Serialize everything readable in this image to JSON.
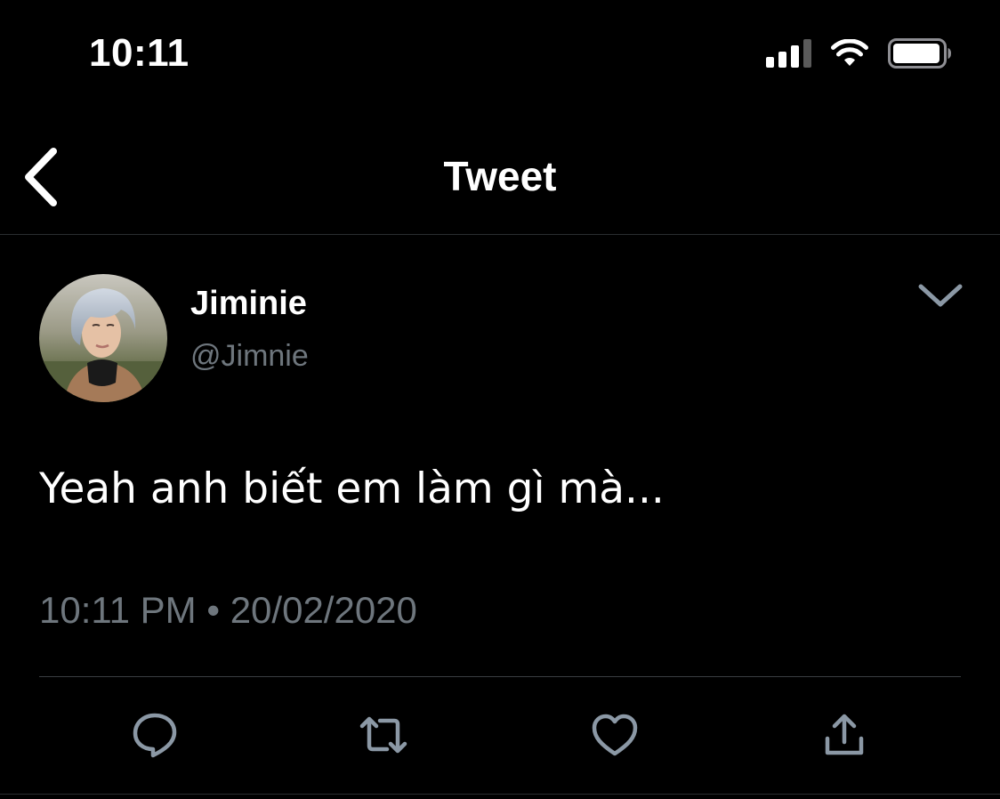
{
  "status_bar": {
    "time": "10:11"
  },
  "nav": {
    "title": "Tweet",
    "back_icon": "chevron-left-icon"
  },
  "tweet": {
    "display_name": "Jiminie",
    "handle": "@Jimnie",
    "text": "Yeah anh biết em làm gì mà...",
    "timestamp": "10:11 PM • 20/02/2020",
    "menu_icon": "chevron-down-icon"
  },
  "actions": [
    {
      "name": "reply",
      "icon": "reply-icon"
    },
    {
      "name": "retweet",
      "icon": "retweet-icon"
    },
    {
      "name": "like",
      "icon": "heart-icon"
    },
    {
      "name": "share",
      "icon": "share-icon"
    }
  ],
  "colors": {
    "background": "#000000",
    "text_primary": "#ffffff",
    "text_secondary": "#6e767d",
    "icon": "#8b98a5",
    "divider": "#2a2d30"
  }
}
